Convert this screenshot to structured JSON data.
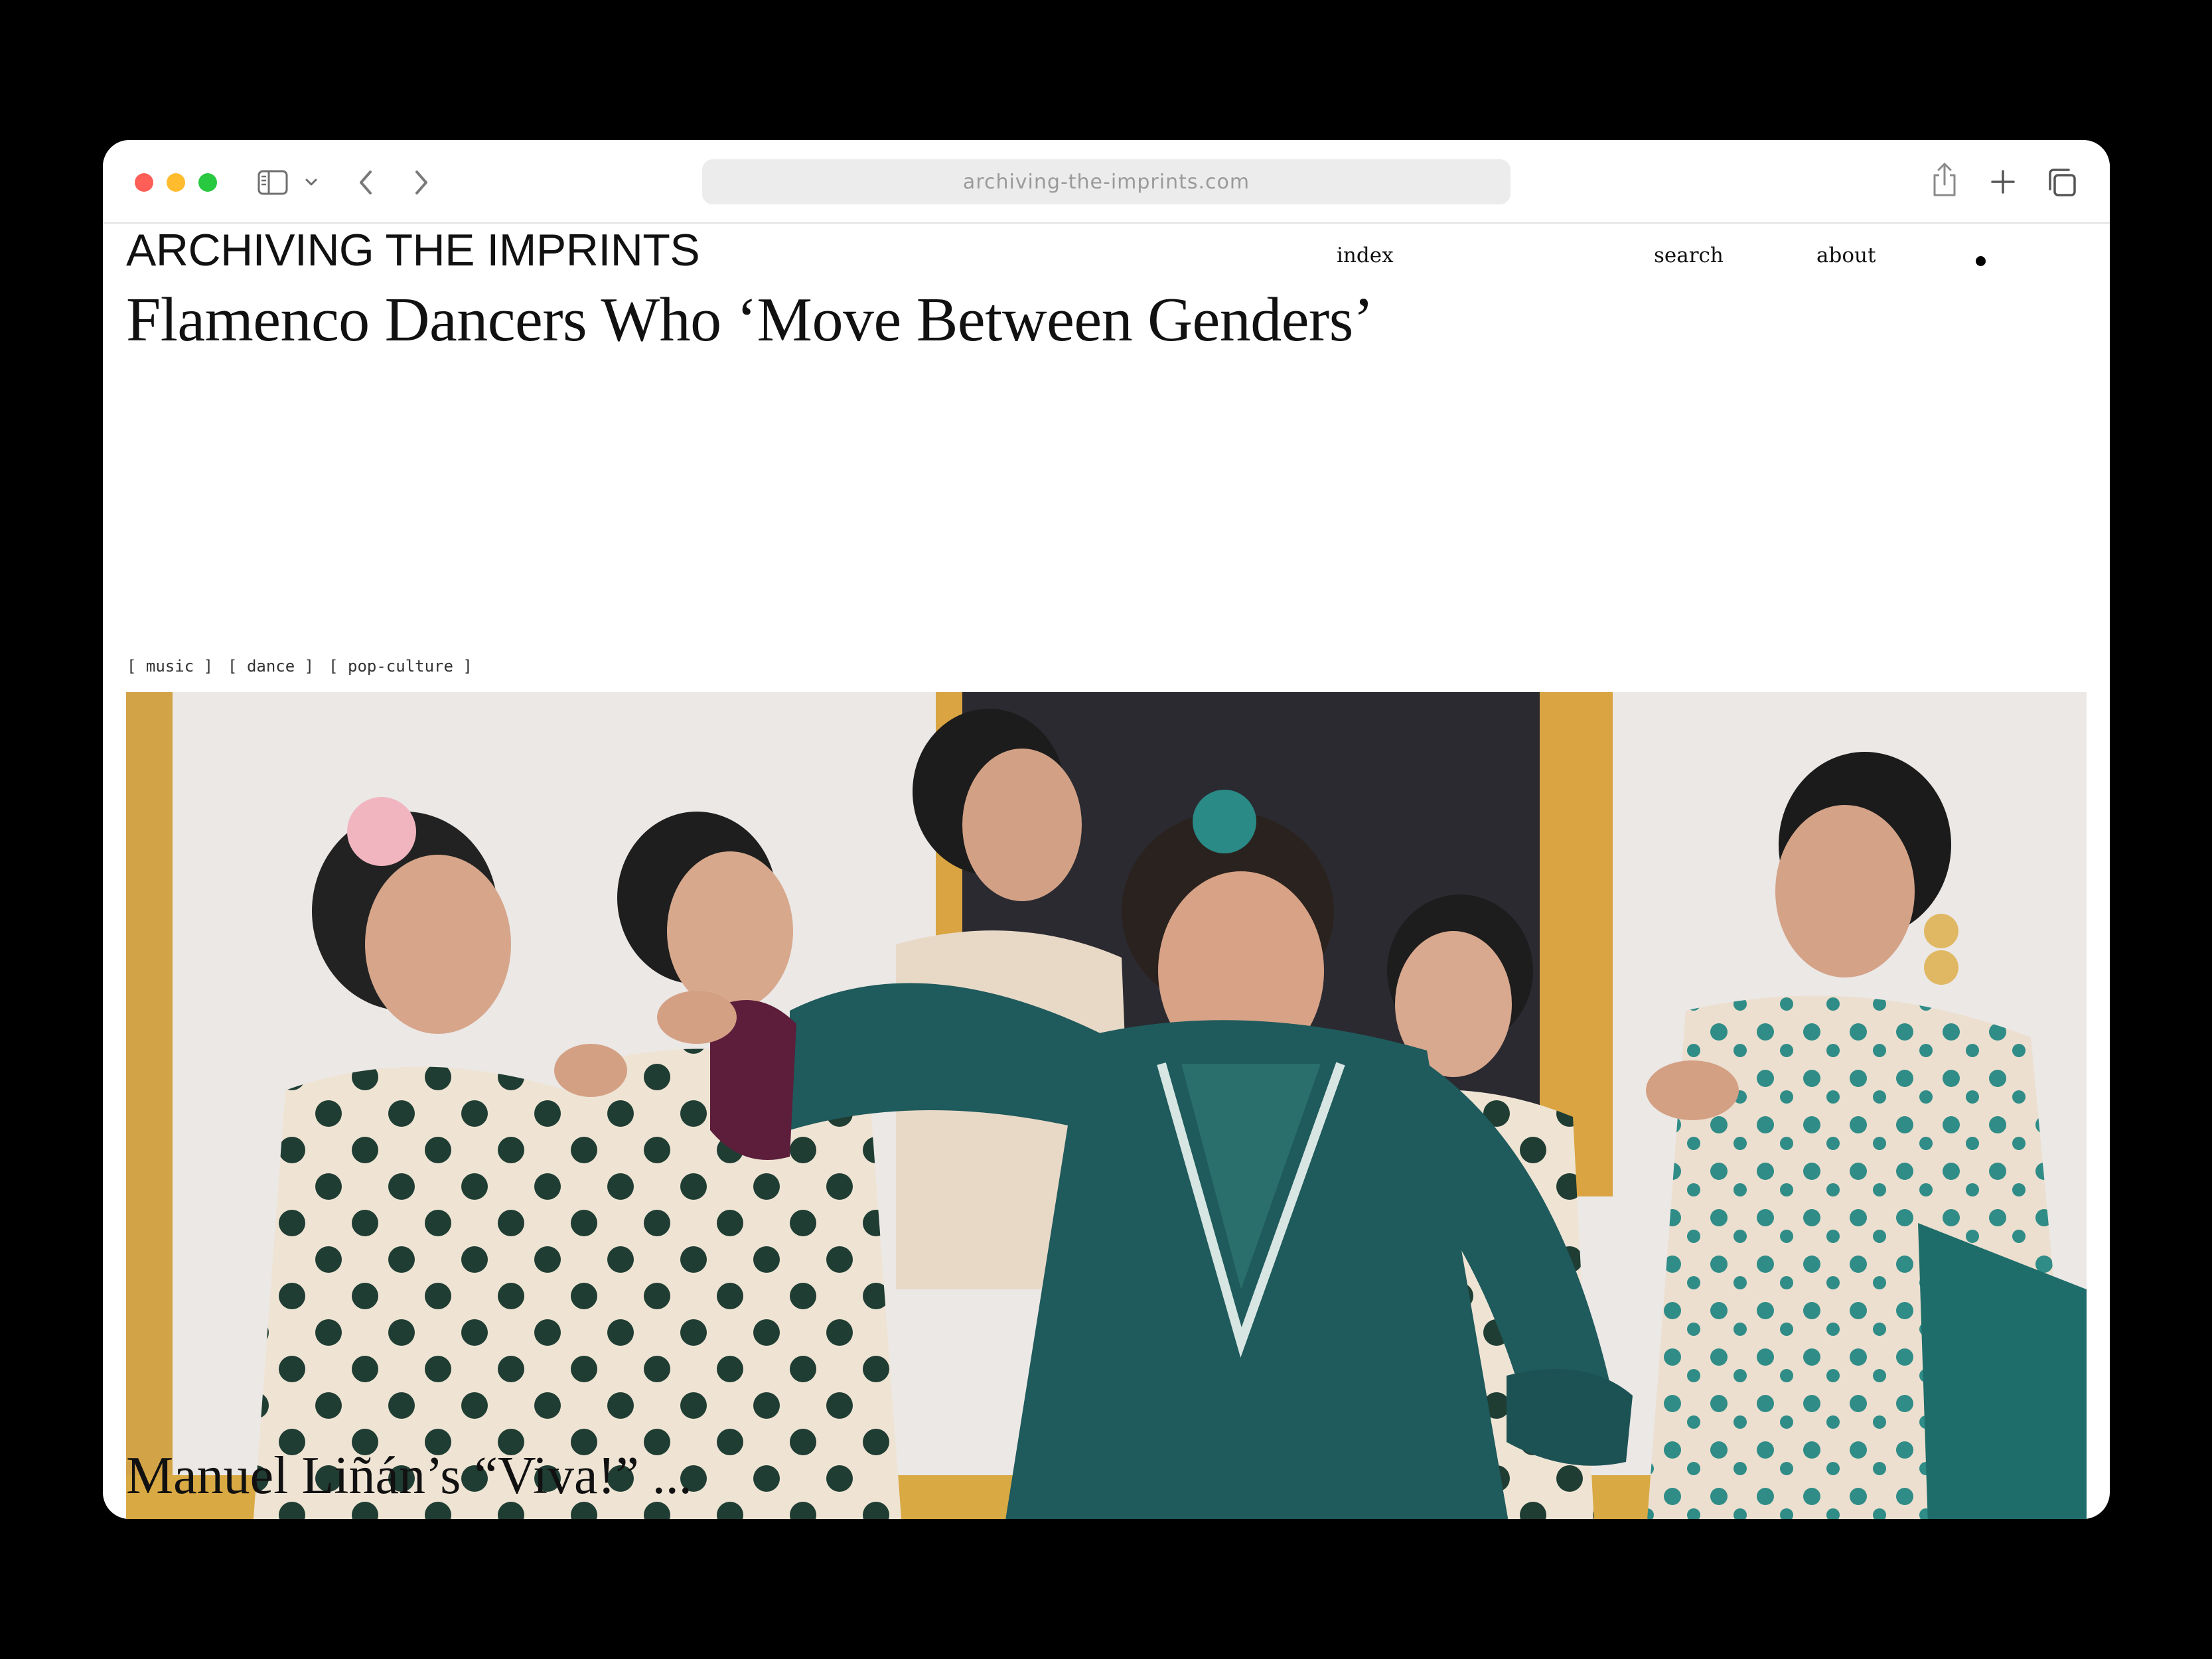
{
  "browser": {
    "url": "archiving-the-imprints.com"
  },
  "site": {
    "title": "ARCHIVING THE IMPRINTS",
    "nav": {
      "index": "index",
      "search": "search",
      "about": "about"
    }
  },
  "article": {
    "headline": "Flamenco Dancers Who ‘Move Between Genders’",
    "tags": [
      "[ music ]",
      "[ dance ]",
      "[ pop-culture ]"
    ],
    "lead_fragment": "Manuel Liñán’s “Viva!” ..."
  },
  "colors": {
    "accent_teal": "#1f5a5c",
    "polka_cream": "#efe3d3",
    "wall": "#ebe8e6",
    "frame_ochre": "#d9a441",
    "backdrop": "#2b2a31"
  },
  "icons": {
    "sidebar": "sidebar-icon",
    "back": "chevron-left-icon",
    "forward": "chevron-right-icon",
    "share": "share-icon",
    "new_tab": "plus-icon",
    "tabs": "tabs-overview-icon"
  }
}
